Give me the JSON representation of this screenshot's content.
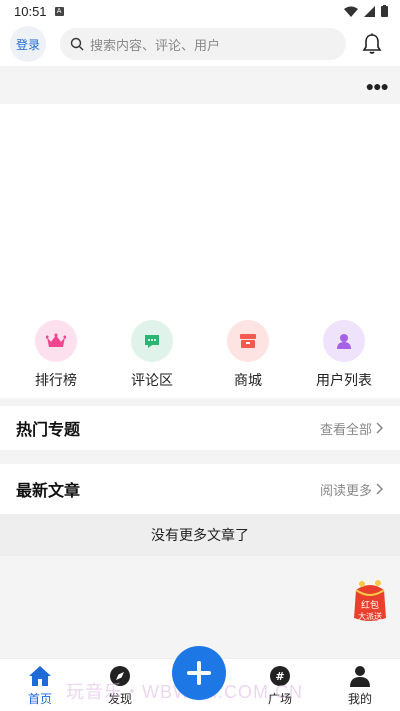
{
  "status": {
    "time": "10:51"
  },
  "header": {
    "login_label": "登录",
    "search_placeholder": "搜索内容、评论、用户"
  },
  "quick_nav": [
    {
      "label": "排行榜",
      "icon": "crown-icon",
      "bg": "#fde0ee",
      "color": "#f0448e"
    },
    {
      "label": "评论区",
      "icon": "comment-icon",
      "bg": "#dff3ea",
      "color": "#2bb673"
    },
    {
      "label": "商城",
      "icon": "store-icon",
      "bg": "#fde3e1",
      "color": "#f05a4f"
    },
    {
      "label": "用户列表",
      "icon": "user-icon",
      "bg": "#efe3fb",
      "color": "#a562e6"
    }
  ],
  "hot_topics": {
    "title": "热门专题",
    "link": "查看全部"
  },
  "latest": {
    "title": "最新文章",
    "link": "阅读更多"
  },
  "empty_text": "没有更多文章了",
  "redpacket": {
    "line1": "红包",
    "line2": "大派送"
  },
  "tabs": [
    {
      "label": "首页",
      "icon": "home-icon",
      "active": true
    },
    {
      "label": "发现",
      "icon": "compass-icon",
      "active": false
    },
    {
      "label": "广场",
      "icon": "hashtag-icon",
      "active": false
    },
    {
      "label": "我的",
      "icon": "profile-icon",
      "active": false
    }
  ],
  "watermark": "玩音乐・WBWXH.COM.CN",
  "colors": {
    "accent": "#1e6ad6",
    "fab": "#1d78e6"
  }
}
